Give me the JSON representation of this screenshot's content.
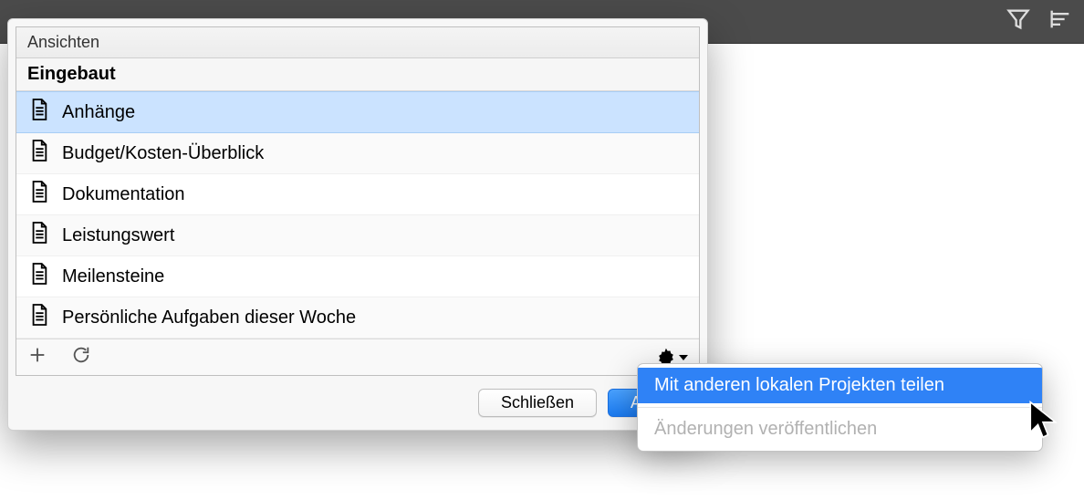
{
  "toolbar": {
    "filter_icon": "filter-icon",
    "align_icon": "align-left-icon"
  },
  "panel": {
    "header": "Ansichten",
    "group": "Eingebaut",
    "rows": [
      {
        "label": "Anhänge",
        "selected": true
      },
      {
        "label": "Budget/Kosten-Überblick",
        "selected": false
      },
      {
        "label": "Dokumentation",
        "selected": false
      },
      {
        "label": "Leistungswert",
        "selected": false
      },
      {
        "label": "Meilensteine",
        "selected": false
      },
      {
        "label": "Persönliche Aufgaben dieser Woche",
        "selected": false
      }
    ],
    "footer": {
      "add_icon": "plus-icon",
      "refresh_icon": "refresh-icon",
      "gear_icon": "gear-icon"
    },
    "buttons": {
      "close": "Schließen",
      "activate": "Aktivi"
    }
  },
  "menu": {
    "items": [
      {
        "label": "Mit anderen lokalen Projekten teilen",
        "state": "highlight"
      },
      {
        "label": "Änderungen veröffentlichen",
        "state": "disabled"
      }
    ]
  }
}
